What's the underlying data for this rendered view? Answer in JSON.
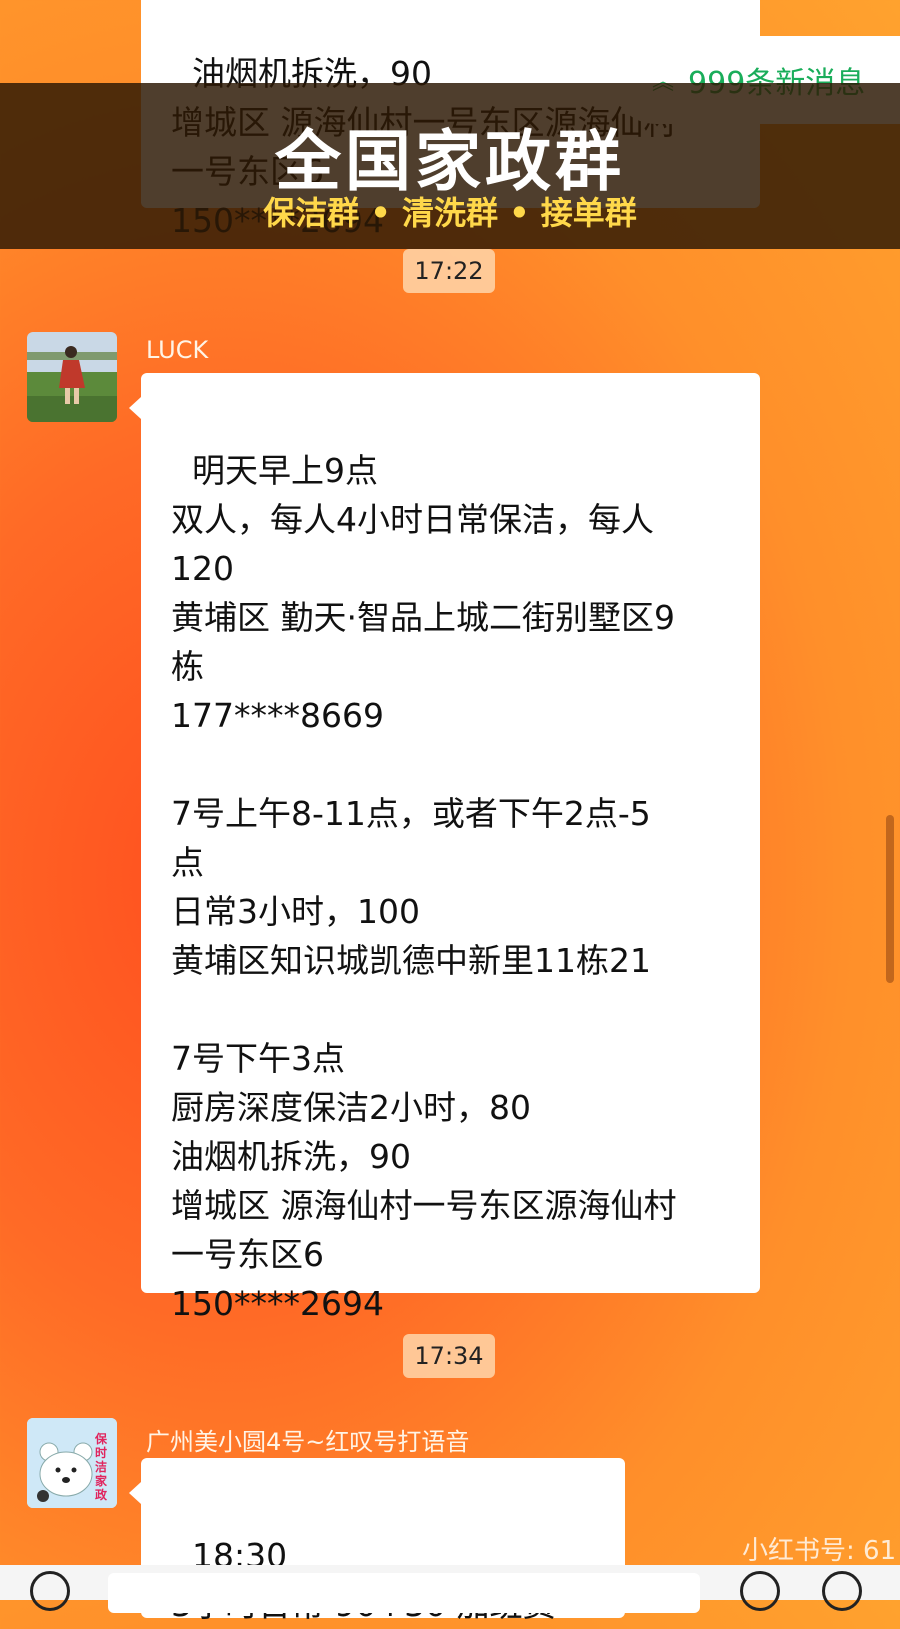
{
  "messages": [
    {
      "id": "prev",
      "text": "油烟机拆洗，90\n增城区 源海仙村一号东区源海仙村\n一号东区6\n150****2694"
    },
    {
      "id": "luck",
      "time": "17:22",
      "sender": "LUCK",
      "text": "明天早上9点\n双人，每人4小时日常保洁，每人\n120\n黄埔区 勤天·智品上城二街别墅区9\n栋\n177****8669\n\n7号上午8-11点，或者下午2点-5\n点\n日常3小时，100\n黄埔区知识城凯德中新里11栋21\n\n7号下午3点\n厨房深度保洁2小时，80\n油烟机拆洗，90\n增城区 源海仙村一号东区源海仙村\n一号东区6\n150****2694"
    },
    {
      "id": "guangzhou",
      "time": "17:34",
      "sender": "广州美小圆4号~红叹号打语音",
      "avatar_text": "保时洁家政",
      "text": "18:30\n3小时日常 90+30 加班费"
    }
  ],
  "overlay": {
    "title": "全国家政群",
    "subtitle": "保洁群 • 清洗群 • 接单群"
  },
  "new_messages": {
    "label": "999条新消息",
    "icon": "double-chevron-up-icon"
  },
  "watermark": "小红书号: 61",
  "colors": {
    "background_from": "#ff4f1f",
    "background_to": "#ffa22e",
    "bubble": "#ffffff",
    "new_message_text": "#1aad5a",
    "overlay_subtitle": "#ffd84a"
  }
}
